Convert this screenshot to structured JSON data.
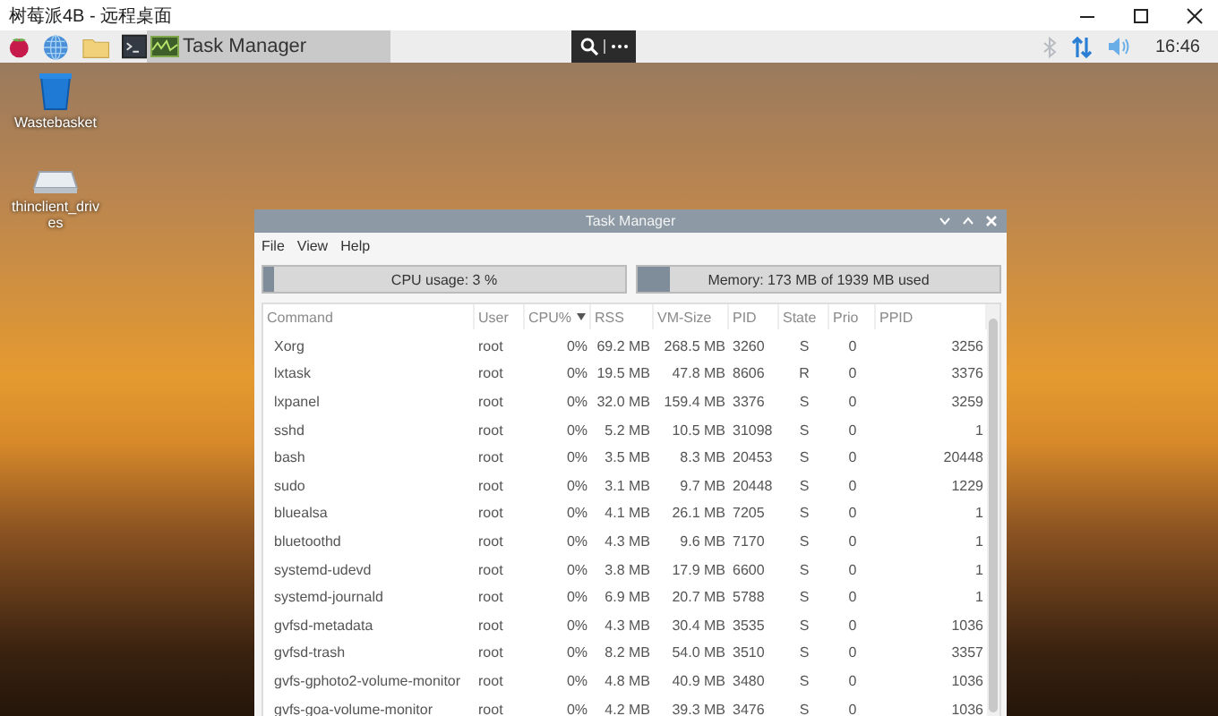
{
  "remote_window": {
    "title": "树莓派4B - 远程桌面"
  },
  "taskbar": {
    "task_button": {
      "label": "Task Manager",
      "selected": true
    },
    "clock": "16:46"
  },
  "desktop_icons": [
    {
      "kind": "trash",
      "label": "Wastebasket"
    },
    {
      "kind": "drive",
      "label": "thinclient_drives"
    }
  ],
  "task_manager": {
    "title": "Task Manager",
    "menu": [
      "File",
      "View",
      "Help"
    ],
    "cpu": {
      "label": "CPU usage: 3 %",
      "level": 0.03
    },
    "memory": {
      "label": "Memory: 173 MB of 1939 MB used",
      "level": 0.09
    },
    "columns": [
      {
        "label": "Command",
        "sorted": false
      },
      {
        "label": "User",
        "sorted": false
      },
      {
        "label": "CPU%",
        "sorted": true
      },
      {
        "label": "RSS",
        "sorted": false
      },
      {
        "label": "VM-Size",
        "sorted": false
      },
      {
        "label": "PID",
        "sorted": false
      },
      {
        "label": "State",
        "sorted": false
      },
      {
        "label": "Prio",
        "sorted": false
      },
      {
        "label": "PPID",
        "sorted": false
      }
    ],
    "rows": [
      [
        "Xorg",
        "root",
        "0%",
        "69.2 MB",
        "268.5 MB",
        "3260",
        "S",
        "0",
        "3256"
      ],
      [
        "lxtask",
        "root",
        "0%",
        "19.5 MB",
        "47.8 MB",
        "8606",
        "R",
        "0",
        "3376"
      ],
      [
        "lxpanel",
        "root",
        "0%",
        "32.0 MB",
        "159.4 MB",
        "3376",
        "S",
        "0",
        "3259"
      ],
      [
        "sshd",
        "root",
        "0%",
        "5.2 MB",
        "10.5 MB",
        "31098",
        "S",
        "0",
        "1"
      ],
      [
        "bash",
        "root",
        "0%",
        "3.5 MB",
        "8.3 MB",
        "20453",
        "S",
        "0",
        "20448"
      ],
      [
        "sudo",
        "root",
        "0%",
        "3.1 MB",
        "9.7 MB",
        "20448",
        "S",
        "0",
        "1229"
      ],
      [
        "bluealsa",
        "root",
        "0%",
        "4.1 MB",
        "26.1 MB",
        "7205",
        "S",
        "0",
        "1"
      ],
      [
        "bluetoothd",
        "root",
        "0%",
        "4.3 MB",
        "9.6 MB",
        "7170",
        "S",
        "0",
        "1"
      ],
      [
        "systemd-udevd",
        "root",
        "0%",
        "3.8 MB",
        "17.9 MB",
        "6600",
        "S",
        "0",
        "1"
      ],
      [
        "systemd-journald",
        "root",
        "0%",
        "6.9 MB",
        "20.7 MB",
        "5788",
        "S",
        "0",
        "1"
      ],
      [
        "gvfsd-metadata",
        "root",
        "0%",
        "4.3 MB",
        "30.4 MB",
        "3535",
        "S",
        "0",
        "1036"
      ],
      [
        "gvfsd-trash",
        "root",
        "0%",
        "8.2 MB",
        "54.0 MB",
        "3510",
        "S",
        "0",
        "3357"
      ],
      [
        "gvfs-gphoto2-volume-monitor",
        "root",
        "0%",
        "4.8 MB",
        "40.9 MB",
        "3480",
        "S",
        "0",
        "1036"
      ],
      [
        "gvfs-goa-volume-monitor",
        "root",
        "0%",
        "4.2 MB",
        "39.3 MB",
        "3476",
        "S",
        "0",
        "1036"
      ]
    ]
  }
}
